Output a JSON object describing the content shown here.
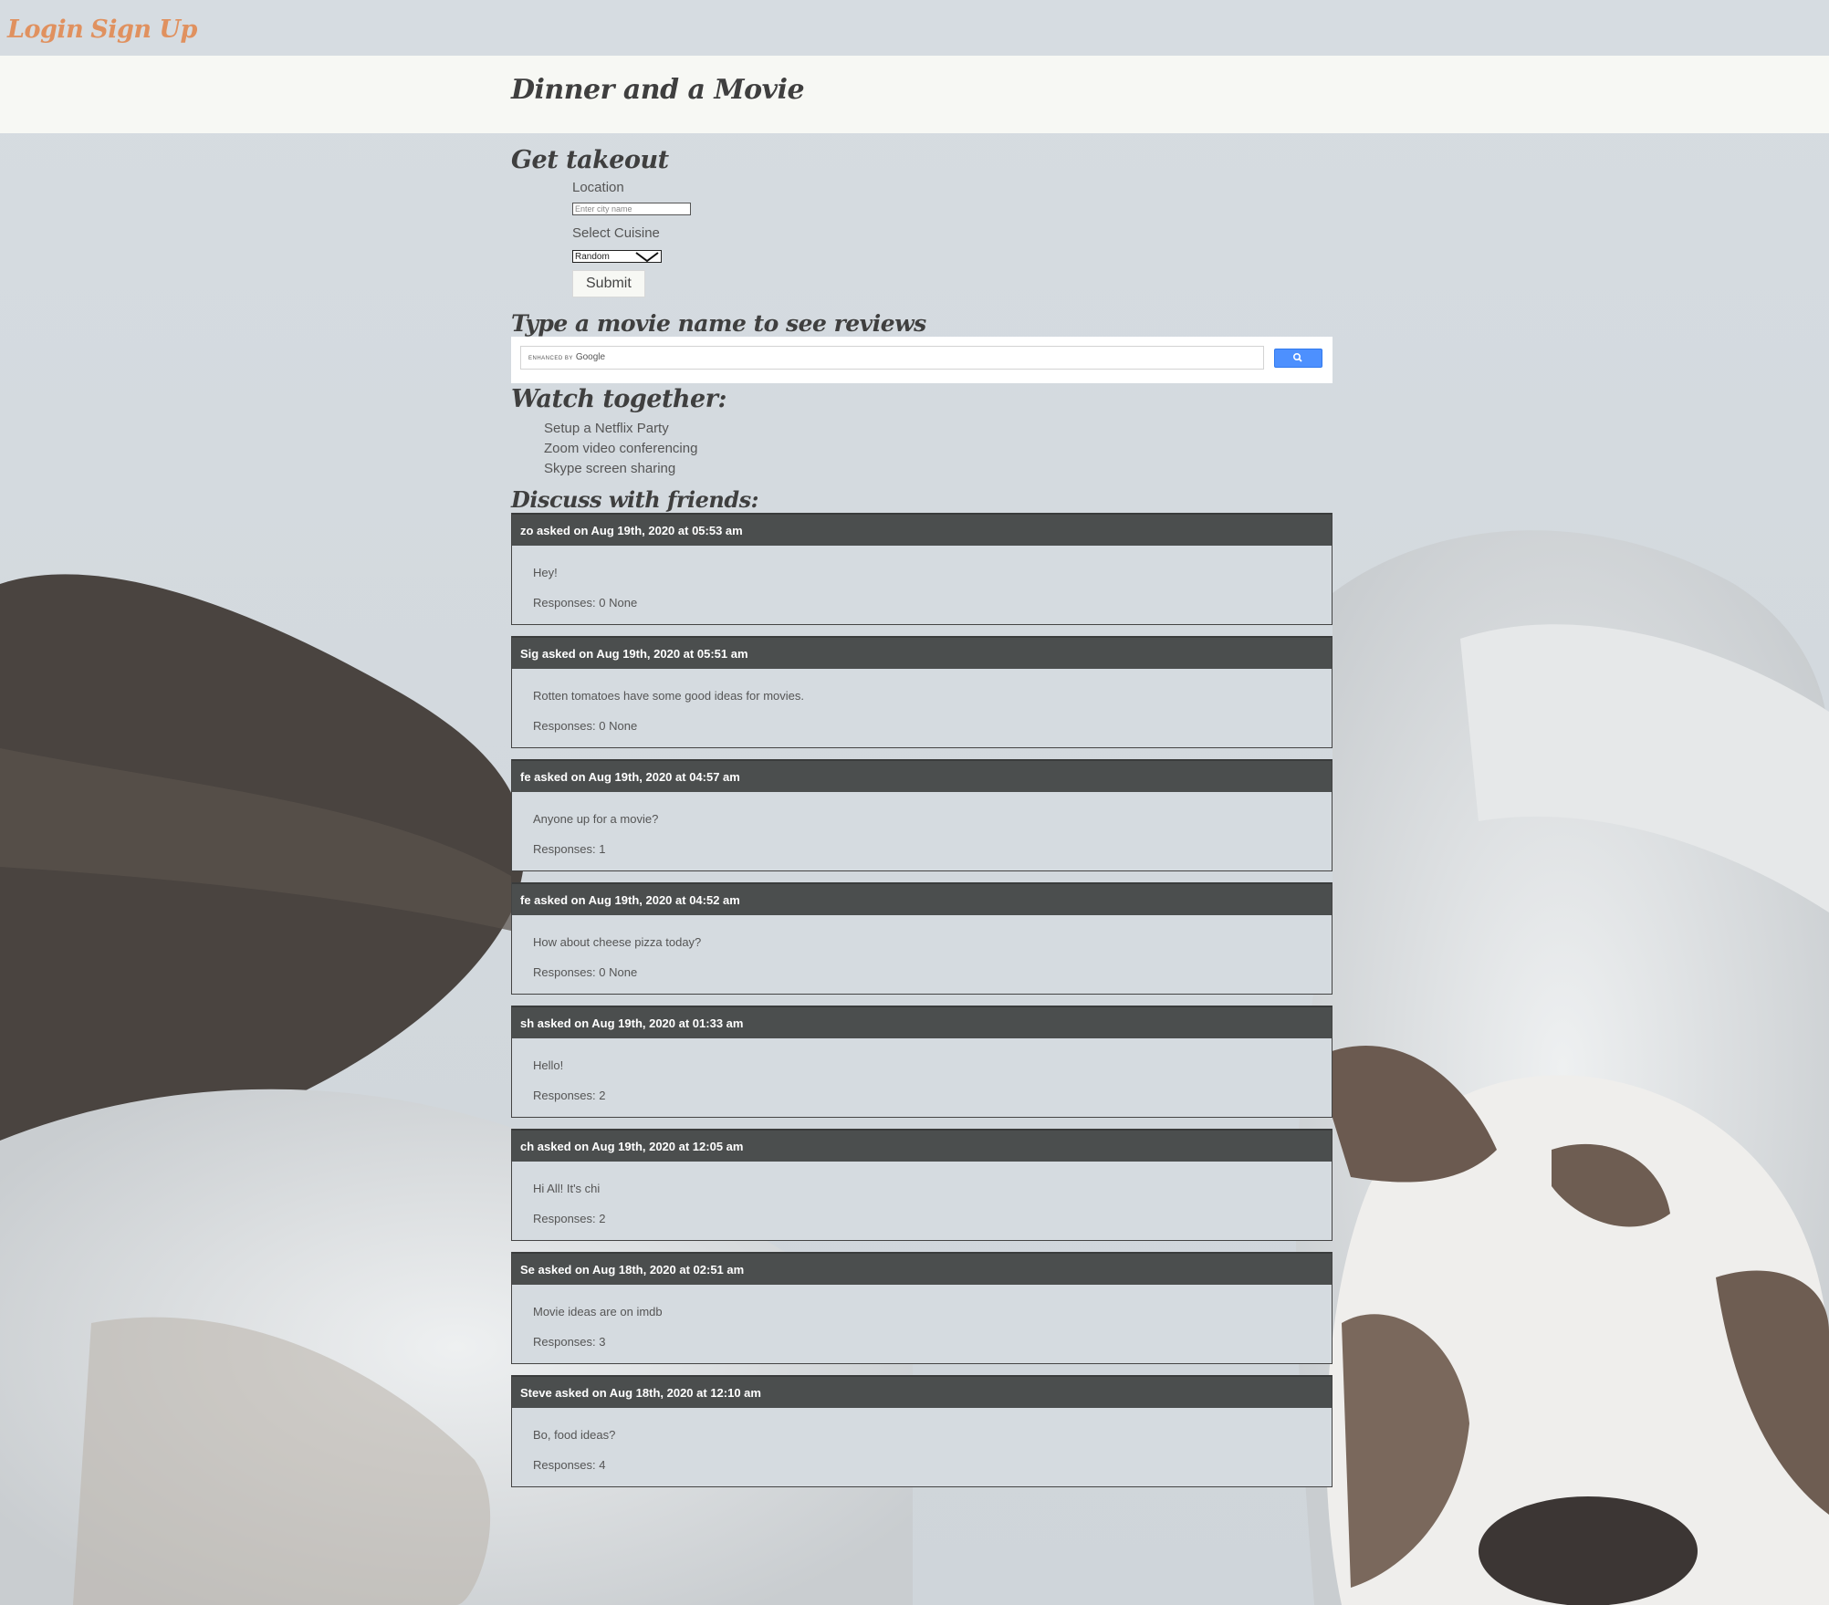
{
  "auth": {
    "login": "Login",
    "signup": "Sign Up"
  },
  "site_title": "Dinner and a Movie",
  "takeout": {
    "title": "Get takeout",
    "location_label": "Location",
    "location_placeholder": "Enter city name",
    "cuisine_label": "Select Cuisine",
    "cuisine_selected": "Random",
    "submit_label": "Submit"
  },
  "reviews": {
    "title": "Type a movie name to see reviews",
    "search_brand_small": "ENHANCED BY",
    "search_brand": "Google"
  },
  "watch": {
    "title": "Watch together:",
    "items": [
      "Setup a Netflix Party",
      "Zoom video conferencing",
      "Skype screen sharing"
    ]
  },
  "discuss": {
    "title": "Discuss with friends:",
    "posts": [
      {
        "header": "zo asked on Aug 19th, 2020 at 05:53 am",
        "text": "Hey!",
        "responses": "Responses: 0 None"
      },
      {
        "header": "Sig asked on Aug 19th, 2020 at 05:51 am",
        "text": "Rotten tomatoes have some good ideas for movies.",
        "responses": "Responses: 0 None"
      },
      {
        "header": "fe asked on Aug 19th, 2020 at 04:57 am",
        "text": "Anyone up for a movie?",
        "responses": "Responses: 1"
      },
      {
        "header": "fe asked on Aug 19th, 2020 at 04:52 am",
        "text": "How about cheese pizza today?",
        "responses": "Responses: 0 None"
      },
      {
        "header": "sh asked on Aug 19th, 2020 at 01:33 am",
        "text": "Hello!",
        "responses": "Responses: 2"
      },
      {
        "header": "ch asked on Aug 19th, 2020 at 12:05 am",
        "text": "Hi All! It's chi",
        "responses": "Responses: 2"
      },
      {
        "header": "Se asked on Aug 18th, 2020 at 02:51 am",
        "text": "Movie ideas are on imdb",
        "responses": "Responses: 3"
      },
      {
        "header": "Steve asked on Aug 18th, 2020 at 12:10 am",
        "text": "Bo, food ideas?",
        "responses": "Responses: 4"
      }
    ]
  },
  "colors": {
    "accent": "#e0915f",
    "post_header": "#4b4e4e",
    "header_band": "#f7f8f4",
    "search_button": "#4d90fe"
  }
}
